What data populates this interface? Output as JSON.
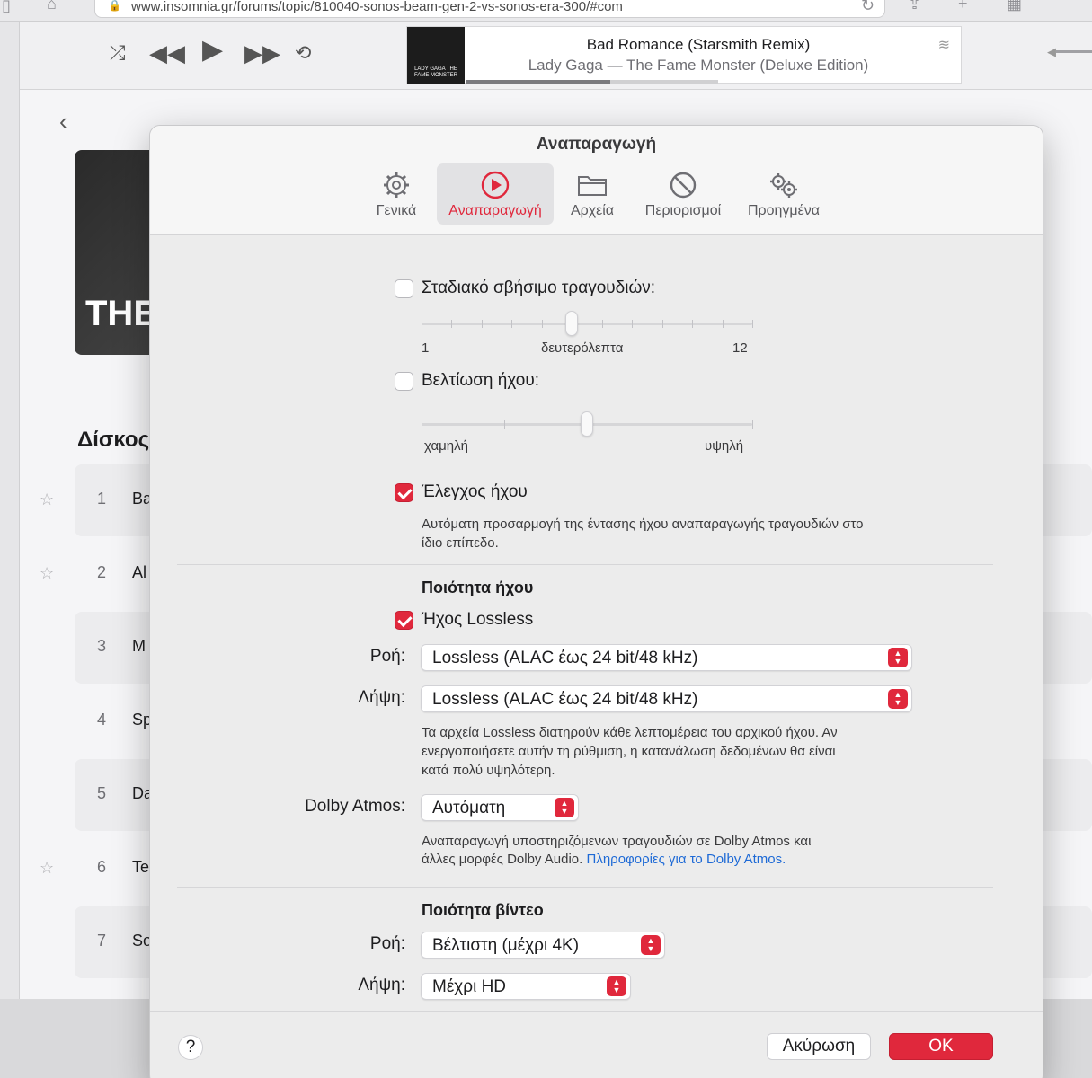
{
  "browser": {
    "url": "www.insomnia.gr/forums/topic/810040-sonos-beam-gen-2-vs-sonos-era-300/#com"
  },
  "player": {
    "track_title": "Bad Romance (Starsmith Remix)",
    "track_subtitle": "Lady Gaga — The Fame Monster (Deluxe Edition)",
    "progress": 0.57,
    "art_caption": "LADY GAGA THE FAME MONSTER"
  },
  "library": {
    "album_text": "THE",
    "section_heading": "Δίσκος",
    "tracks": [
      {
        "num": "1",
        "title": "Ba",
        "starred": true
      },
      {
        "num": "2",
        "title": "Al",
        "starred": true
      },
      {
        "num": "3",
        "title": "M",
        "starred": false
      },
      {
        "num": "4",
        "title": "Sp",
        "starred": false
      },
      {
        "num": "5",
        "title": "Da",
        "starred": false
      },
      {
        "num": "6",
        "title": "Te",
        "starred": true
      },
      {
        "num": "7",
        "title": "So",
        "starred": false
      }
    ],
    "star_glyph": "☆"
  },
  "dialog": {
    "title": "Αναπαραγωγή",
    "tabs": [
      {
        "label": "Γενικά",
        "icon": "gear-icon"
      },
      {
        "label": "Αναπαραγωγή",
        "icon": "play-circle-icon",
        "active": true
      },
      {
        "label": "Αρχεία",
        "icon": "folder-icon"
      },
      {
        "label": "Περιορισμοί",
        "icon": "restriction-icon"
      },
      {
        "label": "Προηγμένα",
        "icon": "gears-icon"
      }
    ],
    "crossfade": {
      "label": "Σταδιακό σβήσιμο τραγουδιών:",
      "checked": false,
      "min_label": "1",
      "unit_label": "δευτερόλεπτα",
      "max_label": "12",
      "value": 6
    },
    "sound_enhancer": {
      "label": "Βελτίωση ήχου:",
      "checked": false,
      "low_label": "χαμηλή",
      "high_label": "υψηλή",
      "value": 0.5
    },
    "sound_check": {
      "label": "Έλεγχος ήχου",
      "checked": true,
      "desc_line1": "Αυτόματη προσαρμογή της έντασης ήχου αναπαραγωγής τραγουδιών στο",
      "desc_line2": "ίδιο επίπεδο."
    },
    "audio_quality": {
      "heading": "Ποιότητα ήχου",
      "lossless_label": "Ήχος Lossless",
      "lossless_checked": true,
      "streaming_label": "Ροή:",
      "streaming_value": "Lossless (ALAC έως 24 bit/48 kHz)",
      "download_label": "Λήψη:",
      "download_value": "Lossless (ALAC έως 24 bit/48 kHz)",
      "desc_line1": "Τα αρχεία Lossless διατηρούν κάθε λεπτομέρεια του αρχικού ήχου. Αν",
      "desc_line2": "ενεργοποιήσετε αυτήν τη ρύθμιση, η κατανάλωση δεδομένων θα είναι",
      "desc_line3": "κατά πολύ υψηλότερη.",
      "dolby_label": "Dolby Atmos:",
      "dolby_value": "Αυτόματη",
      "dolby_desc_line1": "Αναπαραγωγή υποστηριζόμενων τραγουδιών σε Dolby Atmos και",
      "dolby_desc_line2": "άλλες μορφές Dolby Audio.",
      "dolby_link": "Πληροφορίες για το Dolby Atmos."
    },
    "video_quality": {
      "heading": "Ποιότητα βίντεο",
      "streaming_label": "Ροή:",
      "streaming_value": "Βέλτιστη (μέχρι 4K)",
      "download_label": "Λήψη:",
      "download_value": "Μέχρι HD"
    },
    "help_label": "?",
    "cancel_label": "Ακύρωση",
    "ok_label": "OK"
  },
  "colors": {
    "accent": "#e0283c",
    "link": "#1e6ad6"
  }
}
